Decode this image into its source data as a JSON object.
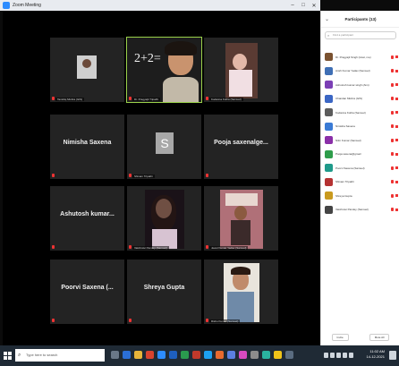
{
  "window": {
    "title": "Zoom Meeting"
  },
  "tiles": [
    {
      "name": "Tanishq Mishra (GIS)"
    },
    {
      "name": "Dr. Pragyajit Tripathi"
    },
    {
      "name": "Kodanna Kotha (Samuel)"
    },
    {
      "name": "",
      "big": "Nimisha Saxena"
    },
    {
      "name": "Shivam Tripathi",
      "avatar_letter": "S"
    },
    {
      "name": "",
      "big": "Pooja saxenalge..."
    },
    {
      "name": "",
      "big": "Ashutosh kumar..."
    },
    {
      "name": "Vaishnavi Pandey (Samuel)"
    },
    {
      "name": "Jewel Kumar Yadav (Samuel)"
    },
    {
      "name": "",
      "big": "Poorvi Saxena (..."
    },
    {
      "name": "",
      "big": "Shreya Gupta"
    },
    {
      "name": "Rishu Kumar (Samuel)"
    }
  ],
  "participants_panel": {
    "title": "Participants (13)",
    "search_placeholder": "Find a participant",
    "items": [
      {
        "name": "Dr. Pragyajit Singh (Host, me)",
        "color": "#7a5230"
      },
      {
        "name": "Ansh Kumar Yadav (Samuel)",
        "color": "#3f6fb5"
      },
      {
        "name": "Ashutosh kumar singh (Aim)",
        "color": "#7b3fb5"
      },
      {
        "name": "Chandan Mishra (GIS)",
        "color": "#3b66c4"
      },
      {
        "name": "Kodanna Kotha (Samuel)",
        "color": "#5c5c5c"
      },
      {
        "name": "Nimisha Saxena",
        "color": "#3a7bd5"
      },
      {
        "name": "Nitin Kumar (Samuel)",
        "color": "#8a2fa8"
      },
      {
        "name": "Pooja saxena@gmail",
        "color": "#2f9d4b"
      },
      {
        "name": "Poorvi Saxena (Samuel)",
        "color": "#1f9a8a"
      },
      {
        "name": "Shivam Tripathi",
        "color": "#b53232"
      },
      {
        "name": "Shreya Gupta",
        "color": "#c99a1f"
      },
      {
        "name": "Vaishnavi Pandey (Samuel)",
        "color": "#444444"
      }
    ],
    "footer": {
      "invite": "Invite",
      "mute_all": "Mute All"
    }
  },
  "taskbar": {
    "search_placeholder": "Type here to search",
    "time": "11:02 AM",
    "date": "14-12-2021"
  },
  "icons": [
    "search-icon",
    "windows-icon",
    "minimize-icon",
    "maximize-icon",
    "close-icon",
    "microphone-muted-icon",
    "camera-off-icon"
  ]
}
